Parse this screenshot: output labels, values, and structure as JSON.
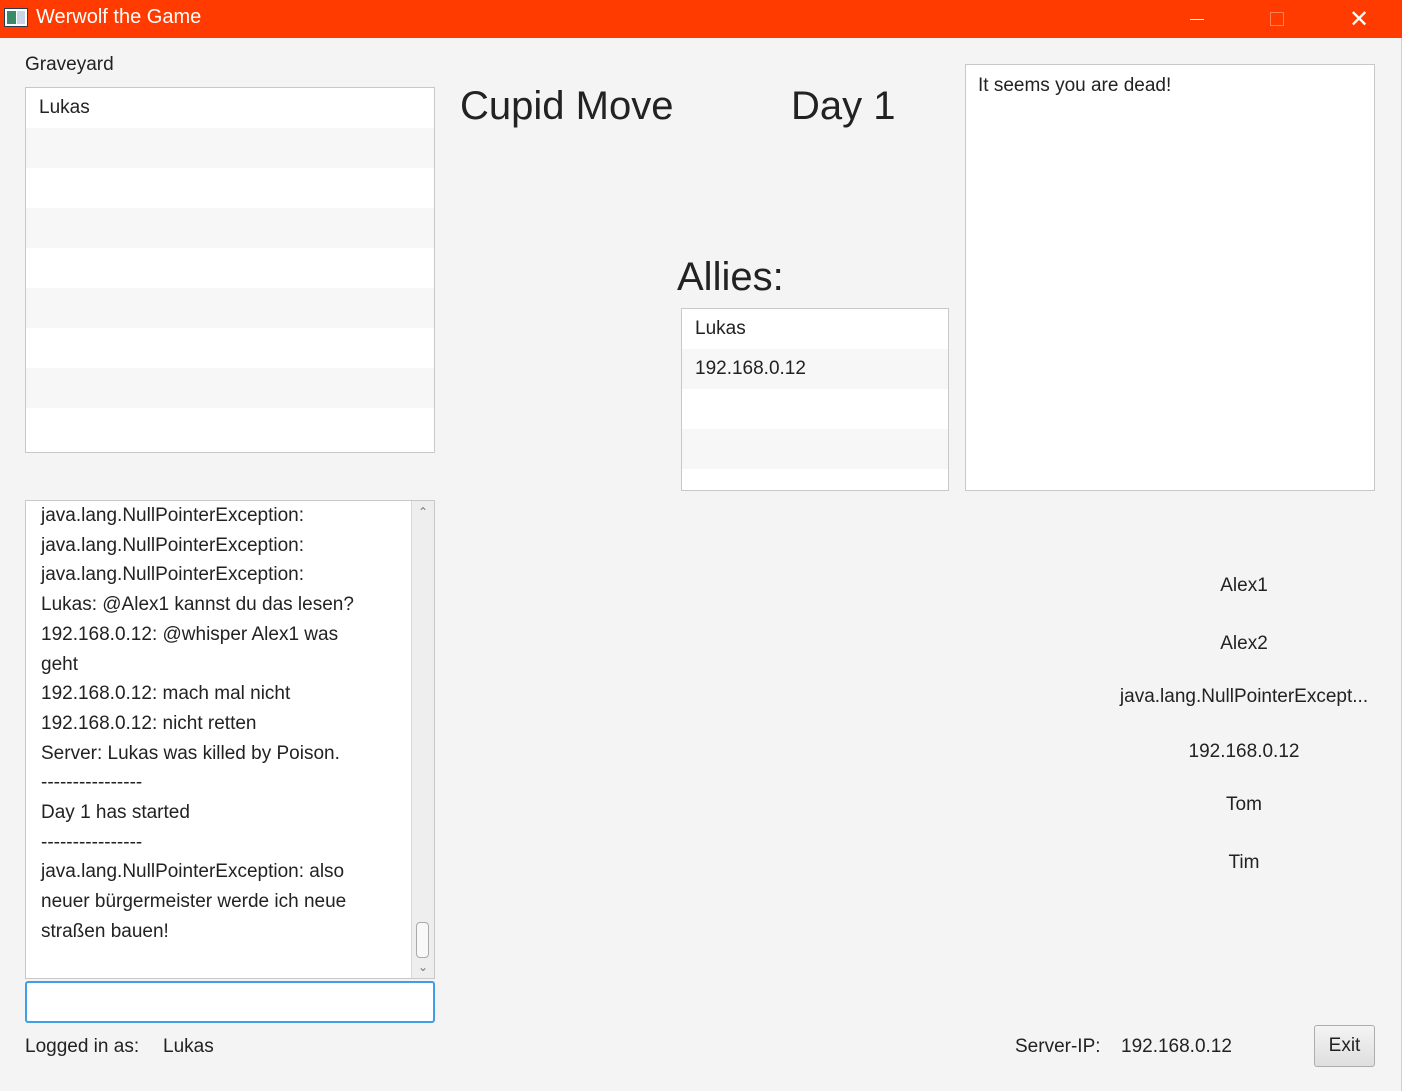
{
  "window": {
    "title": "Werwolf the Game",
    "titlebar_color": "#ff3b00",
    "close_symbol": "✕"
  },
  "graveyard": {
    "label": "Graveyard",
    "items": [
      "Lukas",
      "",
      "",
      "",
      "",
      "",
      "",
      "",
      ""
    ]
  },
  "phase": {
    "move": "Cupid Move",
    "day": "Day 1"
  },
  "allies": {
    "label": "Allies:",
    "items": [
      "Lukas",
      "192.168.0.12",
      "",
      ""
    ]
  },
  "message_box": {
    "text": "It seems you are dead!"
  },
  "chat": {
    "lines": [
      "java.lang.NullPointerException:",
      "java.lang.NullPointerException:",
      "java.lang.NullPointerException:",
      "Lukas: @Alex1 kannst du das lesen?",
      "192.168.0.12: @whisper Alex1 was",
      "geht",
      "192.168.0.12: mach mal nicht",
      "192.168.0.12: nicht retten",
      "Server: Lukas was killed by Poison.",
      "----------------",
      "Day 1 has started",
      "----------------",
      "java.lang.NullPointerException: also",
      "neuer bürgermeister werde ich neue",
      "straßen bauen!"
    ],
    "input_value": ""
  },
  "players": [
    "Alex1",
    "Alex2",
    "java.lang.NullPointerExcept...",
    "192.168.0.12",
    "Tom",
    "Tim"
  ],
  "footer": {
    "logged_in_label": "Logged in as:",
    "logged_in_user": "Lukas",
    "server_ip_label": "Server-IP:",
    "server_ip": "192.168.0.12",
    "exit_label": "Exit"
  }
}
